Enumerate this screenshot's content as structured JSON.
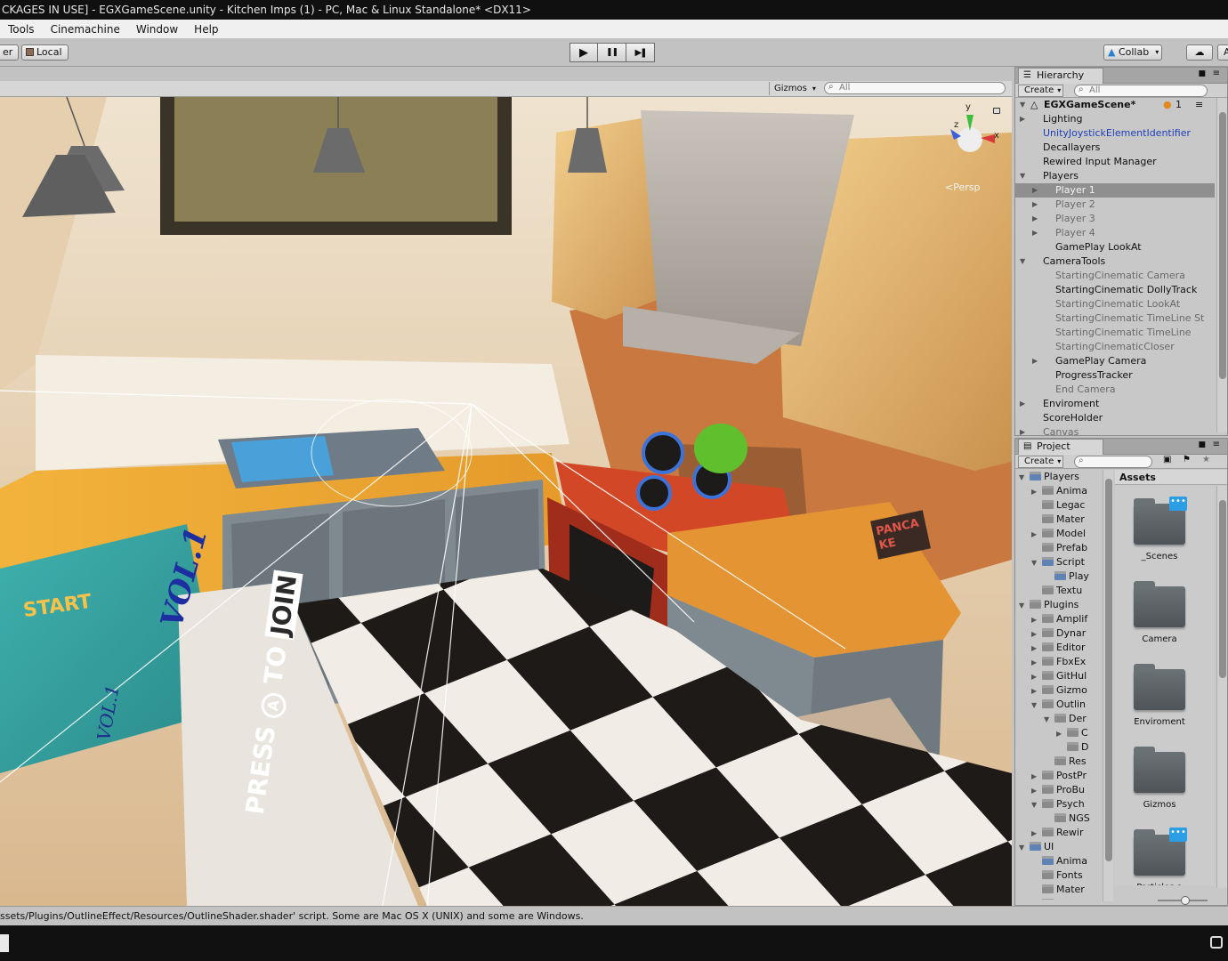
{
  "window": {
    "title": "CKAGES IN USE] - EGXGameScene.unity - Kitchen Imps (1) - PC, Mac & Linux Standalone* <DX11>"
  },
  "menu": [
    "Tools",
    "Cinemachine",
    "Window",
    "Help"
  ],
  "toolbar": {
    "left_button": "er",
    "local_button": "Local",
    "play_icon": "▶",
    "pause_icon": "❚❚",
    "step_icon": "▶❚",
    "collab_label": "Collab",
    "account_label": "A"
  },
  "scene": {
    "gizmos_label": "Gizmos",
    "search_placeholder": "All",
    "persp_label": "Persp",
    "axis_y": "y",
    "axis_x": "x",
    "axis_z": "z",
    "overlay_text": {
      "start": "START",
      "vol": "VOL.1",
      "vol_small": "VOL.1",
      "press": "PRESS",
      "button_a": "A",
      "to": "TO",
      "join": "JOIN",
      "poster": "PANCAKE"
    }
  },
  "hierarchy": {
    "tab_label": "Hierarchy",
    "create_label": "Create",
    "search_placeholder": "All",
    "scene_name": "EGXGameScene*",
    "collab_count": "1",
    "items": [
      {
        "label": "Lighting",
        "indent": 1,
        "arrow": "▶",
        "style": "normal"
      },
      {
        "label": "UnityJoystickElementIdentifier",
        "indent": 1,
        "arrow": "",
        "style": "blue"
      },
      {
        "label": "Decallayers",
        "indent": 1,
        "arrow": "",
        "style": "normal"
      },
      {
        "label": "Rewired Input Manager",
        "indent": 1,
        "arrow": "",
        "style": "normal"
      },
      {
        "label": "Players",
        "indent": 1,
        "arrow": "▼",
        "style": "normal"
      },
      {
        "label": "Player 1",
        "indent": 2,
        "arrow": "▶",
        "style": "selected"
      },
      {
        "label": "Player 2",
        "indent": 2,
        "arrow": "▶",
        "style": "dim"
      },
      {
        "label": "Player 3",
        "indent": 2,
        "arrow": "▶",
        "style": "dim"
      },
      {
        "label": "Player 4",
        "indent": 2,
        "arrow": "▶",
        "style": "dim"
      },
      {
        "label": "GamePlay LookAt",
        "indent": 2,
        "arrow": "",
        "style": "normal"
      },
      {
        "label": "CameraTools",
        "indent": 1,
        "arrow": "▼",
        "style": "normal"
      },
      {
        "label": "StartingCinematic Camera",
        "indent": 2,
        "arrow": "",
        "style": "dim"
      },
      {
        "label": "StartingCinematic DollyTrack",
        "indent": 2,
        "arrow": "",
        "style": "normal"
      },
      {
        "label": "StartingCinematic LookAt",
        "indent": 2,
        "arrow": "",
        "style": "dim"
      },
      {
        "label": "StartingCinematic TimeLine St",
        "indent": 2,
        "arrow": "",
        "style": "dim"
      },
      {
        "label": "StartingCinematic TimeLine",
        "indent": 2,
        "arrow": "",
        "style": "dim"
      },
      {
        "label": "StartingCinematicCloser",
        "indent": 2,
        "arrow": "",
        "style": "dim"
      },
      {
        "label": "GamePlay Camera",
        "indent": 2,
        "arrow": "▶",
        "style": "normal"
      },
      {
        "label": "ProgressTracker",
        "indent": 2,
        "arrow": "",
        "style": "normal"
      },
      {
        "label": "End Camera",
        "indent": 2,
        "arrow": "",
        "style": "dim"
      },
      {
        "label": "Enviroment",
        "indent": 1,
        "arrow": "▶",
        "style": "normal"
      },
      {
        "label": "ScoreHolder",
        "indent": 1,
        "arrow": "",
        "style": "normal"
      },
      {
        "label": "Canvas",
        "indent": 1,
        "arrow": "▶",
        "style": "dim"
      }
    ]
  },
  "project": {
    "tab_label": "Project",
    "create_label": "Create",
    "assets_header": "Assets",
    "tree": [
      {
        "label": "Players",
        "indent": 1,
        "arrow": "▼",
        "blue": true
      },
      {
        "label": "Anima",
        "indent": 2,
        "arrow": "▶",
        "blue": false
      },
      {
        "label": "Legac",
        "indent": 2,
        "arrow": "",
        "blue": false
      },
      {
        "label": "Mater",
        "indent": 2,
        "arrow": "",
        "blue": false
      },
      {
        "label": "Model",
        "indent": 2,
        "arrow": "▶",
        "blue": false
      },
      {
        "label": "Prefab",
        "indent": 2,
        "arrow": "",
        "blue": false
      },
      {
        "label": "Script",
        "indent": 2,
        "arrow": "▼",
        "blue": true
      },
      {
        "label": "Play",
        "indent": 3,
        "arrow": "",
        "blue": true
      },
      {
        "label": "Textu",
        "indent": 2,
        "arrow": "",
        "blue": false
      },
      {
        "label": "Plugins",
        "indent": 1,
        "arrow": "▼",
        "blue": false
      },
      {
        "label": "Amplif",
        "indent": 2,
        "arrow": "▶",
        "blue": false
      },
      {
        "label": "Dynar",
        "indent": 2,
        "arrow": "▶",
        "blue": false
      },
      {
        "label": "Editor",
        "indent": 2,
        "arrow": "▶",
        "blue": false
      },
      {
        "label": "FbxEx",
        "indent": 2,
        "arrow": "▶",
        "blue": false
      },
      {
        "label": "GitHul",
        "indent": 2,
        "arrow": "▶",
        "blue": false
      },
      {
        "label": "Gizmo",
        "indent": 2,
        "arrow": "▶",
        "blue": false
      },
      {
        "label": "Outlin",
        "indent": 2,
        "arrow": "▼",
        "blue": false
      },
      {
        "label": "Der",
        "indent": 3,
        "arrow": "▼",
        "blue": false
      },
      {
        "label": "C",
        "indent": 4,
        "arrow": "▶",
        "blue": false
      },
      {
        "label": "D",
        "indent": 4,
        "arrow": "",
        "blue": false
      },
      {
        "label": "Res",
        "indent": 3,
        "arrow": "",
        "blue": false
      },
      {
        "label": "PostPr",
        "indent": 2,
        "arrow": "▶",
        "blue": false
      },
      {
        "label": "ProBu",
        "indent": 2,
        "arrow": "▶",
        "blue": false
      },
      {
        "label": "Psych",
        "indent": 2,
        "arrow": "▼",
        "blue": false
      },
      {
        "label": "NGS",
        "indent": 3,
        "arrow": "",
        "blue": false
      },
      {
        "label": "Rewir",
        "indent": 2,
        "arrow": "▶",
        "blue": false
      },
      {
        "label": "UI",
        "indent": 1,
        "arrow": "▼",
        "blue": true
      },
      {
        "label": "Anima",
        "indent": 2,
        "arrow": "",
        "blue": true
      },
      {
        "label": "Fonts",
        "indent": 2,
        "arrow": "",
        "blue": false
      },
      {
        "label": "Mater",
        "indent": 2,
        "arrow": "",
        "blue": false
      },
      {
        "label": "Prefab",
        "indent": 2,
        "arrow": "",
        "blue": false
      }
    ],
    "assets": [
      {
        "label": "_Scenes",
        "badge": true
      },
      {
        "label": "Camera",
        "badge": false
      },
      {
        "label": "Enviroment",
        "badge": false
      },
      {
        "label": "Gizmos",
        "badge": false
      },
      {
        "label": "Particles a",
        "badge": true
      }
    ],
    "badge_glyph": "•••"
  },
  "status": {
    "message": "ssets/Plugins/OutlineEffect/Resources/OutlineShader.shader' script. Some are Mac OS X (UNIX) and some are Windows."
  },
  "colors": {
    "selected_row": "#8f8f8f",
    "link_blue": "#1f3fb8",
    "accent_blue": "#2b9ee5"
  }
}
